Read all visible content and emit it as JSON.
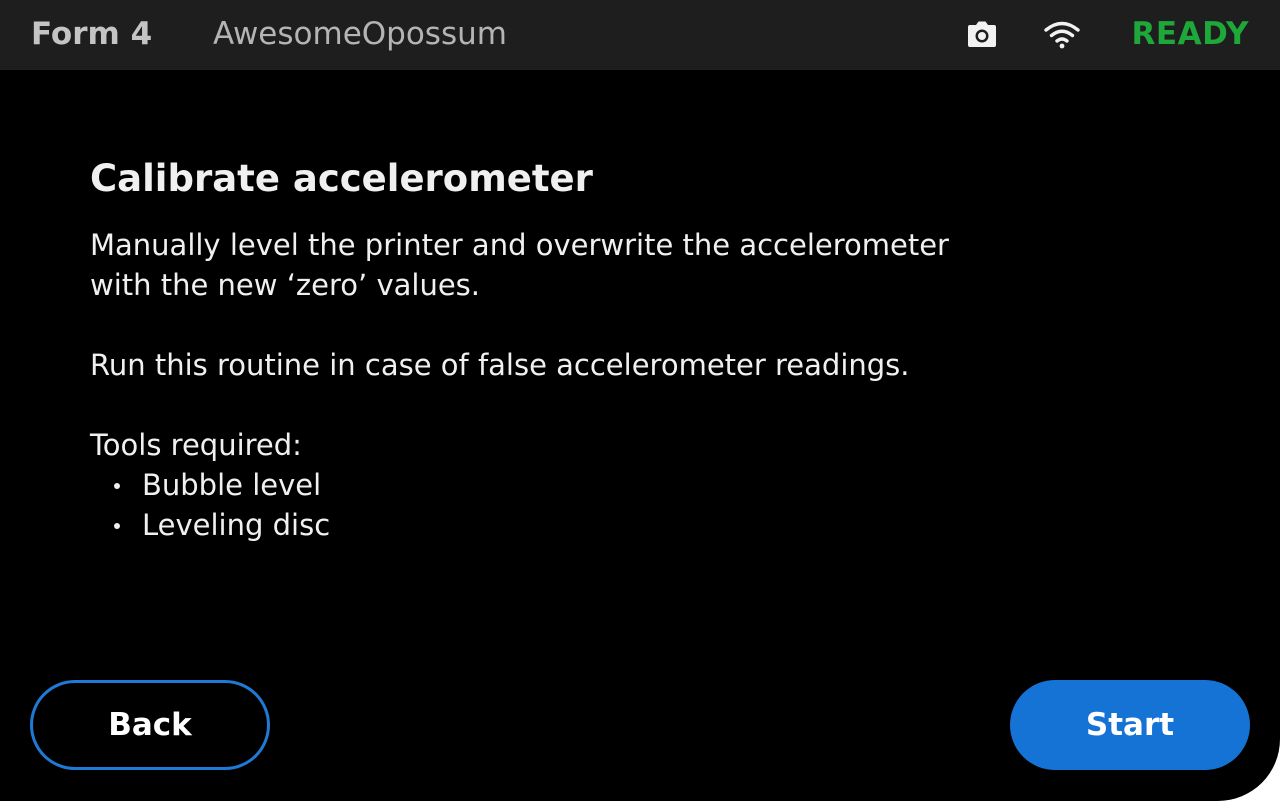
{
  "header": {
    "model": "Form 4",
    "printer_name": "AwesomeOpossum",
    "camera_icon": "camera-icon",
    "wifi_icon": "wifi-icon",
    "status": "READY",
    "status_color": "#1fa83a"
  },
  "main": {
    "title": "Calibrate accelerometer",
    "description_line1": "Manually level the printer and overwrite the accelerometer",
    "description_line2": "with the new ‘zero’ values.",
    "note": "Run this routine in case of false accelerometer readings.",
    "tools_heading": "Tools required:",
    "tools": [
      "Bubble level",
      "Leveling disc"
    ]
  },
  "footer": {
    "back_label": "Back",
    "start_label": "Start",
    "accent_color": "#1673d6"
  }
}
